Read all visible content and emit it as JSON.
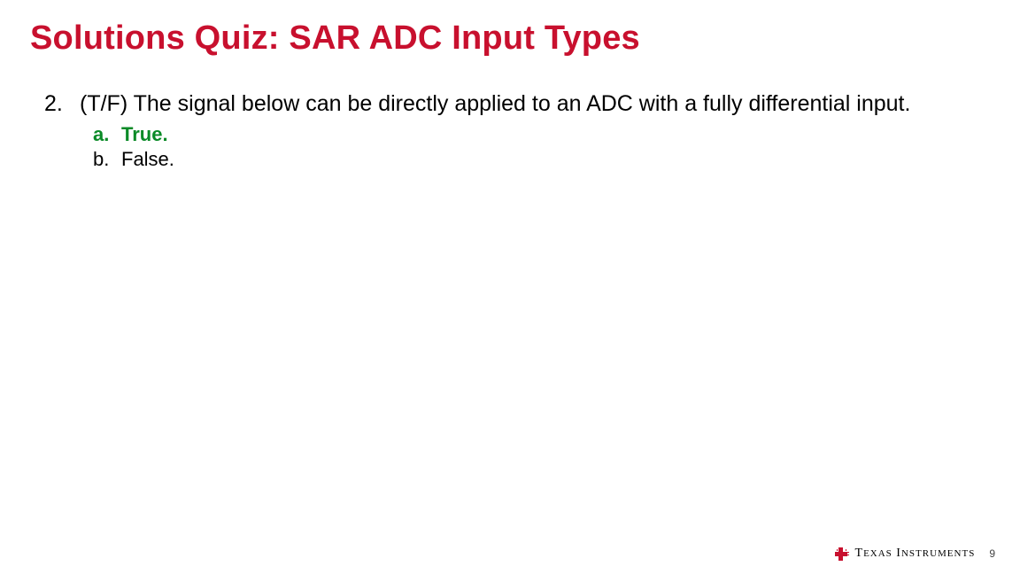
{
  "title": "Solutions Quiz: SAR ADC Input Types",
  "question": {
    "number": "2.",
    "text": "(T/F) The signal below can be directly applied to an ADC with a fully differential input."
  },
  "answers": [
    {
      "letter": "a.",
      "text": "True.",
      "correct": true
    },
    {
      "letter": "b.",
      "text": "False.",
      "correct": false
    }
  ],
  "footer": {
    "brand_left": "T",
    "brand_left_sm": "EXAS",
    "brand_right": "I",
    "brand_right_sm": "NSTRUMENTS",
    "page": "9"
  },
  "colors": {
    "title": "#c8102e",
    "correct": "#0a8a27",
    "logo": "#c8102e"
  }
}
